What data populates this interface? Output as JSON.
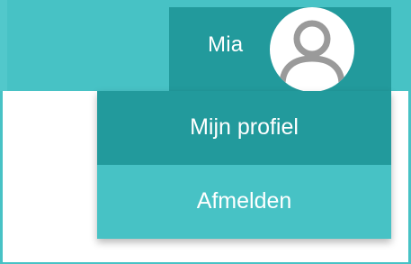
{
  "header": {
    "user_name": "Mia",
    "avatar_icon": "user-avatar-icon"
  },
  "menu": {
    "items": [
      {
        "label": "Mijn profiel"
      },
      {
        "label": "Afmelden"
      }
    ]
  },
  "colors": {
    "header_bg": "#47c2c5",
    "user_area_bg": "#229a9c",
    "menu_active_bg": "#229a9c",
    "menu_item_bg": "#47c2c5",
    "avatar_stroke": "#9a9a9a",
    "text": "#ffffff"
  }
}
